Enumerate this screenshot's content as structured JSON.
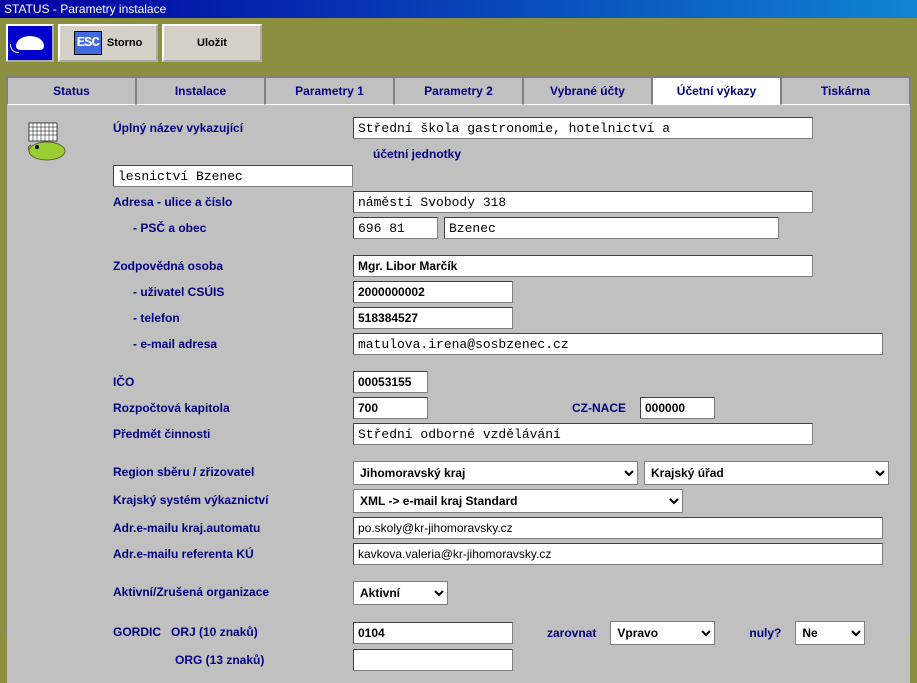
{
  "window": {
    "title": "STATUS - Parametry instalace"
  },
  "toolbar": {
    "storno": "Storno",
    "ulozit": "Uložit"
  },
  "tabs": {
    "status": "Status",
    "instalace": "Instalace",
    "param1": "Parametry 1",
    "param2": "Parametry 2",
    "ucty": "Vybrané účty",
    "vykazy": "Účetní výkazy",
    "tiskarna": "Tiskárna"
  },
  "labels": {
    "uplny_nazev": "Úplný název vykazující",
    "ucetni_jednotky": "účetní jednotky",
    "adresa": "Adresa - ulice a číslo",
    "psc_obec": "- PSČ a obec",
    "zodpovedna": "Zodpovědná osoba",
    "uzivatel": "- uživatel CSÚIS",
    "telefon": "- telefon",
    "email": "- e-mail adresa",
    "ico": "IČO",
    "rozpoctova": "Rozpočtová kapitola",
    "cznace": "CZ-NACE",
    "predmet": "Předmět činnosti",
    "region": "Region sběru / zřizovatel",
    "krajsky": "Krajský systém výkaznictví",
    "adr_automat": "Adr.e-mailu kraj.automatu",
    "adr_referent": "Adr.e-mailu referenta KÚ",
    "aktivni": "Aktivní/Zrušená organizace",
    "gordic_orj": "GORDIC   ORJ (10 znaků)",
    "org": "ORG (13 znaků)",
    "zarovnat": "zarovnat",
    "nuly": "nuly?"
  },
  "values": {
    "nazev1": "Střední škola gastronomie, hotelnictví a",
    "nazev2": "lesnictví Bzenec",
    "adresa": "náměstí Svobody 318",
    "psc": "696 81",
    "obec": "Bzenec",
    "osoba": "Mgr. Libor Marčík",
    "uzivatel": "2000000002",
    "telefon": "518384527",
    "email": "matulova.irena@sosbzenec.cz",
    "ico": "00053155",
    "kapitola": "700",
    "cznace": "000000",
    "predmet": "Střední odborné vzdělávání",
    "region": "Jihomoravský kraj",
    "zrizovatel": "Krajský úřad",
    "krajsky": "XML -> e-mail kraj Standard",
    "adr_automat": "po.skoly@kr-jihomoravsky.cz",
    "adr_referent": "kavkova.valeria@kr-jihomoravsky.cz",
    "aktivni": "Aktivní",
    "orj": "0104",
    "org": "",
    "zarovnat": "Vpravo",
    "nuly": "Ne"
  }
}
